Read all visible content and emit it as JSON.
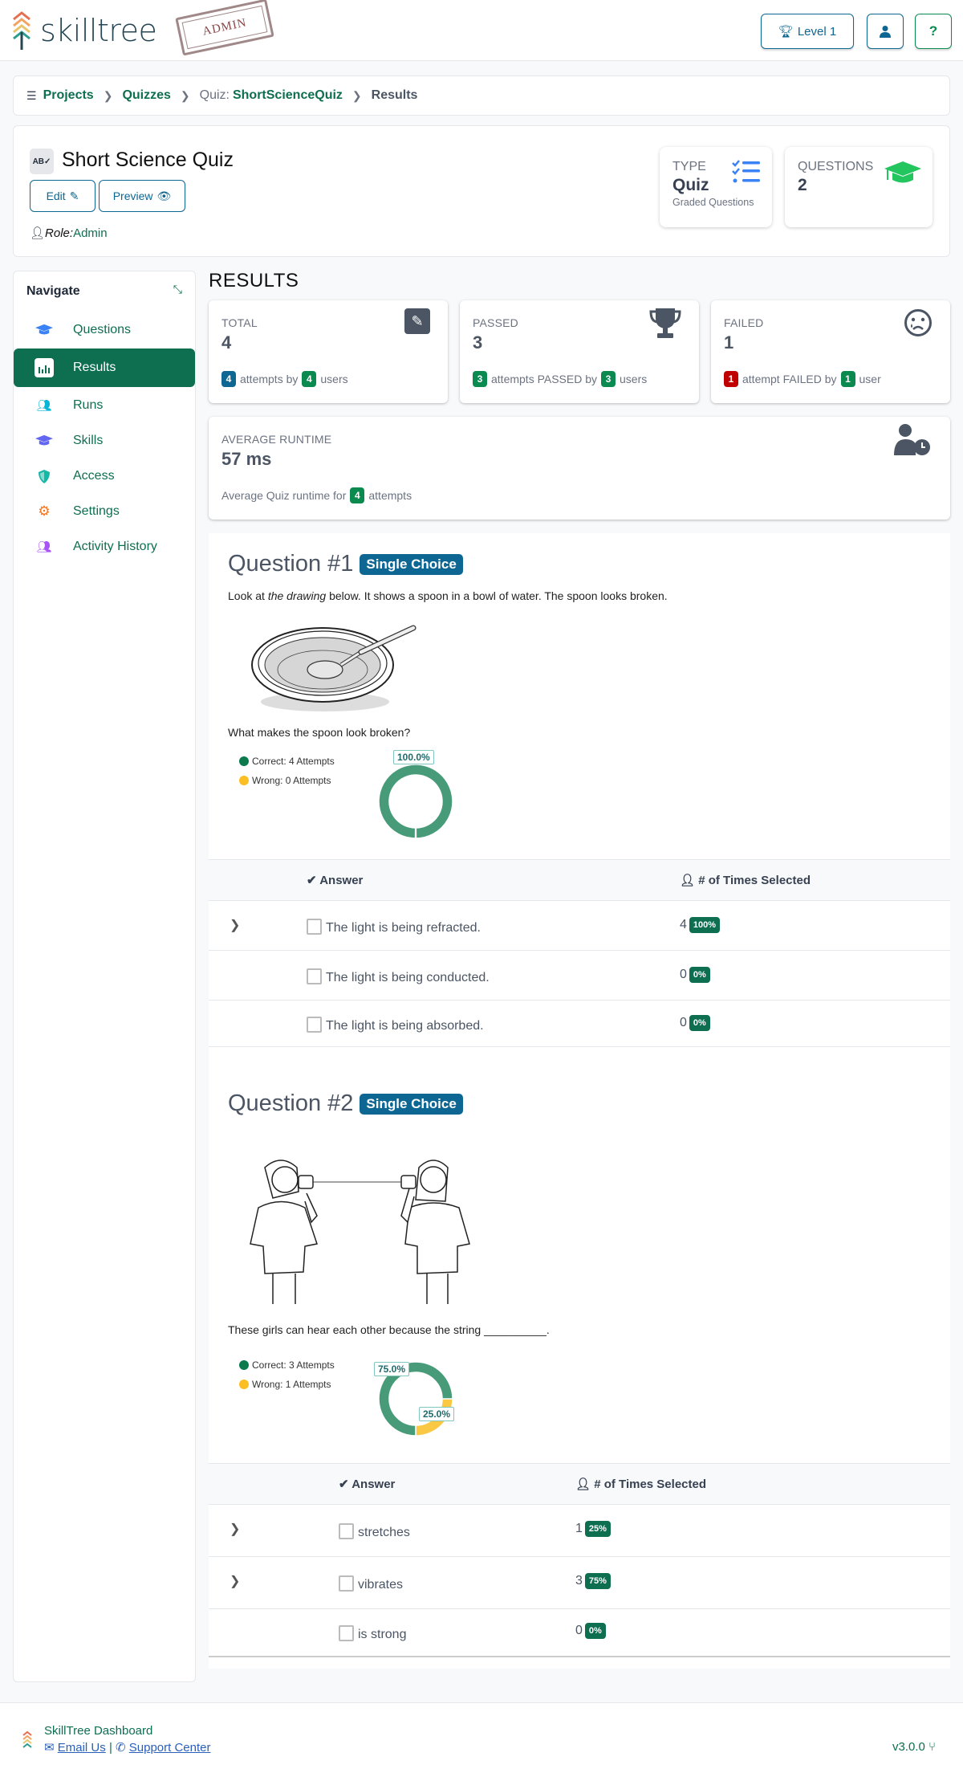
{
  "app": {
    "name": "skilltree",
    "stamp": "ADMIN"
  },
  "topbar": {
    "level_label": "Level 1",
    "user_icon": "user-icon",
    "help_icon": "question-icon"
  },
  "breadcrumb": {
    "items": [
      {
        "label": "Projects",
        "type": "link"
      },
      {
        "label": "Quizzes",
        "type": "link"
      },
      {
        "prefix": "Quiz:",
        "label": "ShortScienceQuiz",
        "type": "link"
      },
      {
        "label": "Results",
        "type": "current"
      }
    ]
  },
  "quiz_header": {
    "title": "Short Science Quiz",
    "edit_label": "Edit",
    "preview_label": "Preview",
    "role_label": "Role:",
    "role_value": "Admin",
    "type_card": {
      "label": "TYPE",
      "value": "Quiz",
      "sub": "Graded Questions"
    },
    "questions_card": {
      "label": "QUESTIONS",
      "value": "2"
    }
  },
  "nav": {
    "title": "Navigate",
    "items": [
      {
        "label": "Questions",
        "icon": "graduation-cap-icon",
        "color": "#3b82f6",
        "active": false
      },
      {
        "label": "Results",
        "icon": "chart-bar-icon",
        "color": "#ffffff",
        "active": true
      },
      {
        "label": "Runs",
        "icon": "users-icon",
        "color": "#06b6d4",
        "active": false
      },
      {
        "label": "Skills",
        "icon": "graduation-cap-icon",
        "color": "#6366f1",
        "active": false
      },
      {
        "label": "Access",
        "icon": "shield-icon",
        "color": "#14b8a6",
        "active": false
      },
      {
        "label": "Settings",
        "icon": "cogs-icon",
        "color": "#f97316",
        "active": false
      },
      {
        "label": "Activity History",
        "icon": "users-cog-icon",
        "color": "#a855f7",
        "active": false
      }
    ]
  },
  "results": {
    "title": "RESULTS",
    "total": {
      "label": "TOTAL",
      "value": "4",
      "attempts": "4",
      "attempts_text": "attempts by",
      "users": "4",
      "users_text": "users"
    },
    "passed": {
      "label": "PASSED",
      "value": "3",
      "attempts": "3",
      "attempts_text": "attempts PASSED by",
      "users": "3",
      "users_text": "users"
    },
    "failed": {
      "label": "FAILED",
      "value": "1",
      "attempts": "1",
      "attempts_text": "attempt FAILED by",
      "users": "1",
      "users_text": "user"
    },
    "runtime": {
      "label": "AVERAGE RUNTIME",
      "value": "57 ms",
      "sub_prefix": "Average Quiz runtime for",
      "attempts": "4",
      "sub_suffix": "attempts"
    }
  },
  "questions": [
    {
      "title": "Question #1",
      "type": "Single Choice",
      "intro_pre": "Look at ",
      "intro_em": "the drawing",
      "intro_post": " below. It shows a spoon in a bowl of water. The spoon looks broken.",
      "image": "spoon-in-bowl-drawing",
      "prompt": "What makes the spoon look broken?",
      "legend": {
        "correct": "Correct: 4 Attempts",
        "wrong": "Wrong: 0 Attempts"
      },
      "chart": {
        "correct": 4,
        "wrong": 0,
        "correct_label": "100.0%",
        "wrong_label": ""
      },
      "table": {
        "col_answer": "Answer",
        "col_times": "# of Times Selected",
        "rows": [
          {
            "answer": "The light is being refracted.",
            "count": "4",
            "pct": "100%",
            "expandable": true
          },
          {
            "answer": "The light is being conducted.",
            "count": "0",
            "pct": "0%",
            "expandable": false
          },
          {
            "answer": "The light is being absorbed.",
            "count": "0",
            "pct": "0%",
            "expandable": false
          }
        ]
      }
    },
    {
      "title": "Question #2",
      "type": "Single Choice",
      "image": "girls-tin-can-telephone-drawing",
      "prompt": "These girls can hear each other because the string __________.",
      "legend": {
        "correct": "Correct: 3 Attempts",
        "wrong": "Wrong: 1 Attempts"
      },
      "chart": {
        "correct": 3,
        "wrong": 1,
        "correct_label": "75.0%",
        "wrong_label": "25.0%"
      },
      "table": {
        "col_answer": "Answer",
        "col_times": "# of Times Selected",
        "rows": [
          {
            "answer": "stretches",
            "count": "1",
            "pct": "25%",
            "expandable": true
          },
          {
            "answer": "vibrates",
            "count": "3",
            "pct": "75%",
            "expandable": true
          },
          {
            "answer": "is strong",
            "count": "0",
            "pct": "0%",
            "expandable": false
          }
        ]
      }
    }
  ],
  "colors": {
    "brand_green": "#0d6e50",
    "brand_blue": "#0e6693",
    "correct": "#0b7a4c",
    "wrong": "#fbbf24"
  },
  "footer": {
    "title": "SkillTree Dashboard",
    "email": "Email Us",
    "support": "Support Center",
    "version": "v3.0.0"
  }
}
